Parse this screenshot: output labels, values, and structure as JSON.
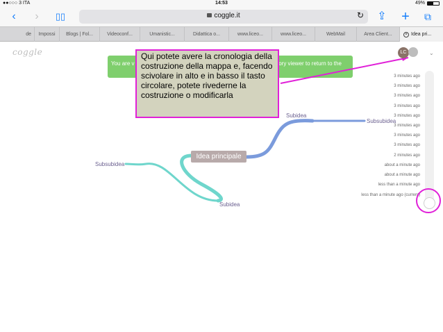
{
  "status": {
    "carrier": "●●○○○ 3 ITA",
    "time": "14:53",
    "battery": "49%",
    "battery_fraction": 0.49
  },
  "browser": {
    "url": "coggle.it",
    "tabs": [
      "de",
      "Impossi",
      "Blogs | Fol...",
      "Videoconf...",
      "Umanistic...",
      "Didattica o...",
      "www.liceo...",
      "www.liceo...",
      "WebMail",
      "Area Client...",
      "Idea pri..."
    ]
  },
  "app": {
    "logo": "coggle",
    "banner_left": "You are v",
    "banner_right": "tory viewer to return to the",
    "callout": "Qui potete avere la cronologia della costruzione della mappa e, facendo scivolare in alto e in basso il tasto circolare, potete rivederne la costruzione o modificarla",
    "avatar_initials": "LC",
    "nodes": {
      "main": "Idea principale",
      "subidea_top": "Subidea",
      "subidea_bottom": "Subidea",
      "subsubidea_right": "Subsubidea",
      "subsubidea_left": "Subsubidea"
    },
    "colors": {
      "branch_blue": "#7b9bdc",
      "branch_teal": "#6fd6cc",
      "highlight": "#e020d8"
    }
  },
  "history": [
    "3 minutes ago",
    "3 minutes ago",
    "3 minutes ago",
    "3 minutes ago",
    "3 minutes ago",
    "3 minutes ago",
    "3 minutes ago",
    "3 minutes ago",
    "2 minutes ago",
    "about a minute ago",
    "about a minute ago",
    "less than a minute ago",
    "less than a minute ago (current)"
  ]
}
